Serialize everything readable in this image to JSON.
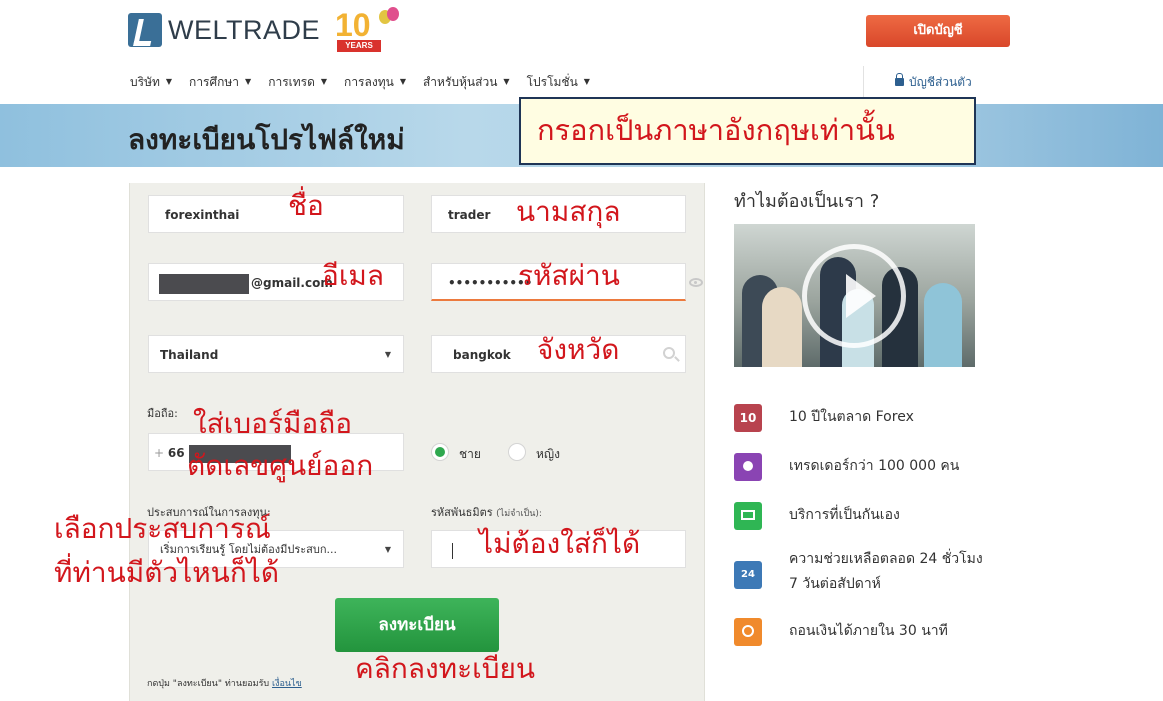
{
  "header": {
    "logo_text": "WELTRADE",
    "anniversary_number": "10",
    "anniversary_ribbon": "YEARS",
    "open_account_label": "เปิดบัญชี",
    "account_link_label": "บัญชีส่วนตัว"
  },
  "nav": {
    "items": [
      {
        "label": "บริษัท"
      },
      {
        "label": "การศึกษา"
      },
      {
        "label": "การเทรด"
      },
      {
        "label": "การลงทุน"
      },
      {
        "label": "สำหรับหุ้นส่วน"
      },
      {
        "label": "โปรโมชั่น"
      }
    ]
  },
  "banner": {
    "title": "ลงทะเบียนโปรไฟล์ใหม่",
    "note": "กรอกเป็นภาษาอังกฤษเท่านั้น"
  },
  "form": {
    "first_name": "forexinthai",
    "last_name": "trader",
    "email_suffix": "@gmail.com",
    "password_mask": "•••••••••••",
    "country": "Thailand",
    "city": "bangkok",
    "mobile_label": "มือถือ:",
    "phone_prefix": "+",
    "phone_code": "66",
    "gender_male": "ชาย",
    "gender_female": "หญิง",
    "experience_label": "ประสบการณ์ในการลงทุน:",
    "experience_value": "เริ่มการเรียนรู้ โดยไม่ต้องมีประสบก...",
    "partner_label": "รหัสพันธมิตร",
    "partner_optional": "(ไม่จำเป็น):",
    "partner_value": "",
    "submit_label": "ลงทะเบียน",
    "terms_text": "กดปุ่ม \"ลงทะเบียน\" ท่านยอมรับ",
    "terms_link": "เงื่อนไข"
  },
  "annotations": {
    "first_name": "ชื่อ",
    "last_name": "นามสกุล",
    "email": "อีเมล",
    "password": "รหัสผ่าน",
    "city": "จังหวัด",
    "phone_line1": "ใส่เบอร์มือถือ",
    "phone_line2": "ตัดเลขศูนย์ออก",
    "experience_line1": "เลือกประสบการณ์",
    "experience_line2": "ที่ท่านมีตัวไหนก็ได้",
    "partner": "ไม่ต้องใส่ก็ได้",
    "submit": "คลิกลงทะเบียน"
  },
  "sidebar": {
    "why_title": "ทำไมต้องเป็นเรา ?",
    "features": [
      {
        "icon": "ten-years-icon",
        "icon_text": "10",
        "color": "#b8434e",
        "text": "10 ปีในตลาด Forex"
      },
      {
        "icon": "trader-user-icon",
        "icon_text": "",
        "color": "#8a44b3",
        "text": "เทรดเดอร์กว่า 100 000 คน"
      },
      {
        "icon": "presentation-icon",
        "icon_text": "",
        "color": "#2fb654",
        "text": "บริการที่เป็นกันเอง"
      },
      {
        "icon": "support-24-icon",
        "icon_text": "24",
        "color": "#3d79b6",
        "text": "ความช่วยเหลือตลอด 24 ชั่วโมง"
      },
      {
        "icon": "stopwatch-icon",
        "icon_text": "",
        "color": "#f08a2c",
        "text": "ถอนเงินได้ภายใน 30 นาที"
      }
    ],
    "support_line2": "7 วันต่อสัปดาห์"
  },
  "colors": {
    "accent_orange": "#e85a35",
    "accent_green": "#2fa84f",
    "annotation_red": "#d2161c",
    "link_blue": "#2d5f8f"
  }
}
